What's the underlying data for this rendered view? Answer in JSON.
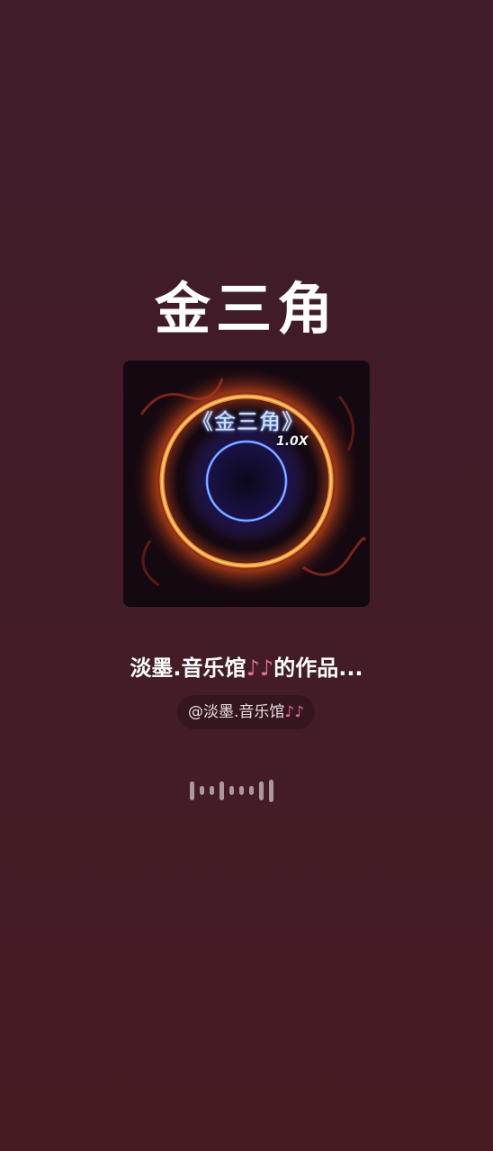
{
  "song": {
    "title": "金三角"
  },
  "cover": {
    "caption": "《金三角》",
    "speed": "1.0X",
    "colors": {
      "outer_ring": "#ff8a2a",
      "inner_ring": "#3a6bff"
    }
  },
  "works": {
    "prefix": "淡墨.音乐馆",
    "note_icon": "music-note-icon",
    "suffix": "的作品..."
  },
  "author": {
    "handle": "@淡墨.音乐馆",
    "note_icon": "music-note-icon"
  },
  "waveform": {
    "icon": "audio-waveform-icon",
    "levels": [
      0.75,
      0.35,
      0.35,
      0.75,
      0.35,
      0.35,
      0.35,
      0.75,
      0.9
    ]
  },
  "colors": {
    "background_top": "#3f1d2b",
    "background_bottom": "#461b22",
    "note": "#e86aa3"
  }
}
